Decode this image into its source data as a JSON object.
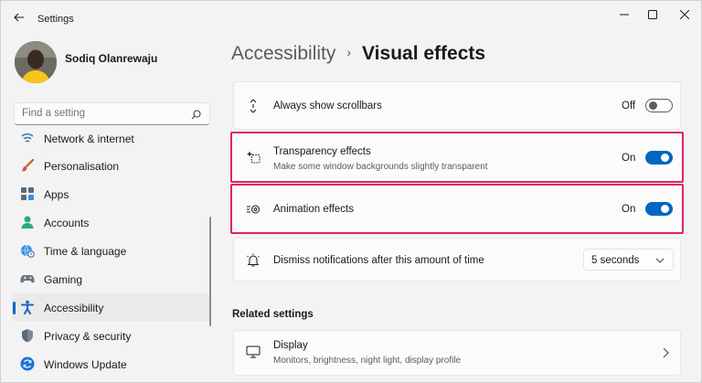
{
  "window": {
    "title": "Settings",
    "colors": {
      "accent": "#0067c0",
      "highlight": "#e0216b",
      "background": "#f3f3f3",
      "card": "#fbfbfb"
    }
  },
  "profile": {
    "name": "Sodiq Olanrewaju"
  },
  "search": {
    "placeholder": "Find a setting",
    "value": ""
  },
  "nav": {
    "items": [
      {
        "label": "Network & internet",
        "icon": "network-icon"
      },
      {
        "label": "Personalisation",
        "icon": "brush-icon"
      },
      {
        "label": "Apps",
        "icon": "apps-icon"
      },
      {
        "label": "Accounts",
        "icon": "person-icon"
      },
      {
        "label": "Time & language",
        "icon": "globe-clock-icon"
      },
      {
        "label": "Gaming",
        "icon": "gamepad-icon"
      },
      {
        "label": "Accessibility",
        "icon": "accessibility-icon",
        "active": true
      },
      {
        "label": "Privacy & security",
        "icon": "shield-icon"
      },
      {
        "label": "Windows Update",
        "icon": "update-icon"
      }
    ]
  },
  "breadcrumb": {
    "parent": "Accessibility",
    "separator": "›",
    "current": "Visual effects"
  },
  "settings": {
    "scrollbars": {
      "title": "Always show scrollbars",
      "state": "Off",
      "on": false,
      "icon": "scrollbar-arrows-icon"
    },
    "transparency": {
      "title": "Transparency effects",
      "subtitle": "Make some window backgrounds slightly transparent",
      "state": "On",
      "on": true,
      "icon": "transparency-sparkle-icon"
    },
    "animation": {
      "title": "Animation effects",
      "state": "On",
      "on": true,
      "icon": "animation-icon"
    },
    "notifications": {
      "title": "Dismiss notifications after this amount of time",
      "value": "5 seconds",
      "icon": "bell-icon"
    }
  },
  "related": {
    "heading": "Related settings",
    "display": {
      "title": "Display",
      "subtitle": "Monitors, brightness, night light, display profile",
      "icon": "monitor-icon"
    }
  }
}
